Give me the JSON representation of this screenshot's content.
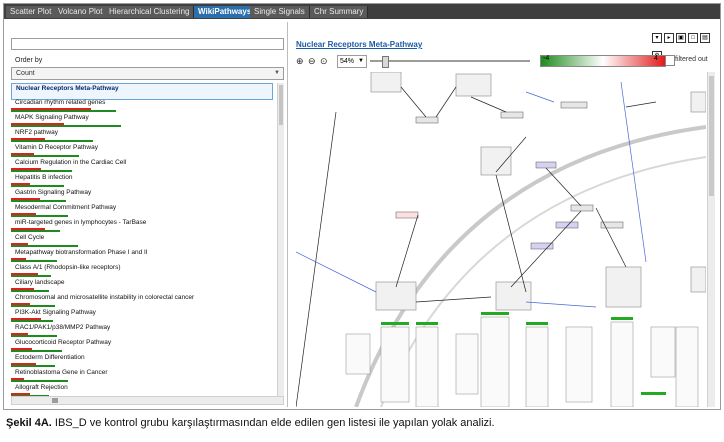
{
  "tabs": [
    {
      "label": "Scatter Plot",
      "active": false
    },
    {
      "label": "Volcano Plot",
      "active": false
    },
    {
      "label": "Hierarchical Clustering",
      "active": false
    },
    {
      "label": "WikiPathways",
      "active": true
    },
    {
      "label": "Single Signals",
      "active": false
    },
    {
      "label": "Chr Summary",
      "active": false
    }
  ],
  "left_panel": {
    "order_by_label": "Order by",
    "order_by_value": "Count",
    "items": [
      {
        "label": "Nuclear Receptors Meta-Pathway",
        "selected": true,
        "red": 0.0,
        "green": 0.0
      },
      {
        "label": "Circadian rhythm related genes",
        "selected": false,
        "red": 0.42,
        "green": 0.55
      },
      {
        "label": "MAPK Signaling Pathway",
        "selected": false,
        "red": 0.28,
        "green": 0.58
      },
      {
        "label": "NRF2 pathway",
        "selected": false,
        "red": 0.18,
        "green": 0.43
      },
      {
        "label": "Vitamin D Receptor Pathway",
        "selected": false,
        "red": 0.12,
        "green": 0.36
      },
      {
        "label": "Calcium Regulation in the Cardiac Cell",
        "selected": false,
        "red": 0.16,
        "green": 0.32
      },
      {
        "label": "Hepatitis B infection",
        "selected": false,
        "red": 0.1,
        "green": 0.28
      },
      {
        "label": "Gastrin Signaling Pathway",
        "selected": false,
        "red": 0.15,
        "green": 0.29
      },
      {
        "label": "Mesodermal Commitment Pathway",
        "selected": false,
        "red": 0.13,
        "green": 0.3
      },
      {
        "label": "miR-targeted genes in lymphocytes - TarBase",
        "selected": false,
        "red": 0.18,
        "green": 0.26
      },
      {
        "label": "Cell Cycle",
        "selected": false,
        "red": 0.09,
        "green": 0.35
      },
      {
        "label": "Metapathway biotransformation Phase I and II",
        "selected": false,
        "red": 0.08,
        "green": 0.24
      },
      {
        "label": "Class A/1 (Rhodopsin-like receptors)",
        "selected": false,
        "red": 0.14,
        "green": 0.21
      },
      {
        "label": "Ciliary landscape",
        "selected": false,
        "red": 0.12,
        "green": 0.2
      },
      {
        "label": "Chromosomal and microsatellite instability in colorectal cancer",
        "selected": false,
        "red": 0.1,
        "green": 0.23
      },
      {
        "label": "PI3K-Akt Signaling Pathway",
        "selected": false,
        "red": 0.16,
        "green": 0.22
      },
      {
        "label": "RAC1/PAK1/p38/MMP2 Pathway",
        "selected": false,
        "red": 0.09,
        "green": 0.24
      },
      {
        "label": "Glucocorticoid Receptor Pathway",
        "selected": false,
        "red": 0.11,
        "green": 0.27
      },
      {
        "label": "Ectoderm Differentiation",
        "selected": false,
        "red": 0.13,
        "green": 0.23
      },
      {
        "label": "Retinoblastoma Gene in Cancer",
        "selected": false,
        "red": 0.07,
        "green": 0.3
      },
      {
        "label": "Allograft Rejection",
        "selected": false,
        "red": 0.1,
        "green": 0.2
      }
    ]
  },
  "right_panel": {
    "pathway_title": "Nuclear Receptors Meta-Pathway",
    "zoom_value": "54%",
    "legend_min": "-4",
    "legend_max": "4",
    "filtered_label": "filtered out",
    "toolbar_icons": [
      "save-icon",
      "export-icon",
      "image-icon",
      "window-icon",
      "print-icon",
      "settings-icon"
    ]
  },
  "caption": {
    "bold": "Şekil 4A.",
    "text": " IBS_D ve kontrol grubu karşılaştırmasından elde edilen gen listesi ile yapılan yolak analizi."
  },
  "colors": {
    "accent_tab": "#2c6fad",
    "title_blue": "#1d5aa6",
    "bar_red": "#e02020",
    "bar_green": "#1f8a1f"
  }
}
